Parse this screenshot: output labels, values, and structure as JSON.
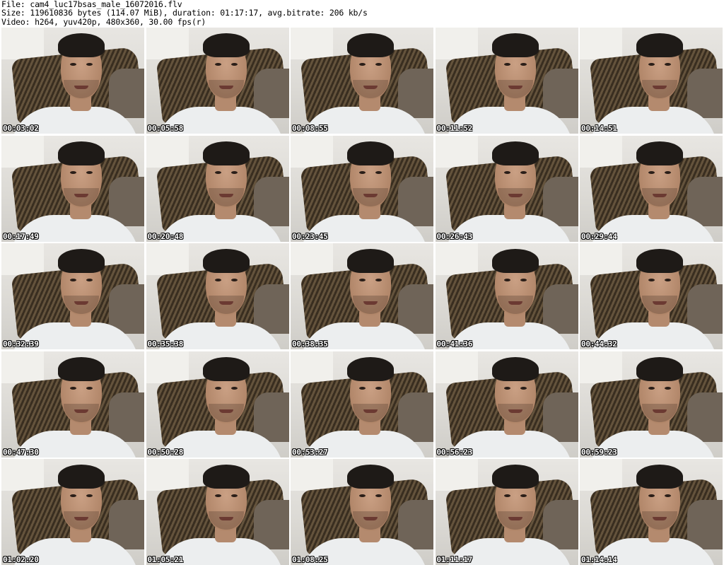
{
  "header": {
    "file_line": "File: cam4_luc17bsas_male_16072016.flv",
    "size_line": "Size: 119610836 bytes (114.07 MiB), duration: 01:17:17, avg.bitrate: 206 kb/s",
    "video_line": "Video: h264, yuv420p, 480x360, 30.00 fps(r)"
  },
  "thumbnails": [
    {
      "timestamp": "00:03:02"
    },
    {
      "timestamp": "00:05:58"
    },
    {
      "timestamp": "00:08:55"
    },
    {
      "timestamp": "00:11:52"
    },
    {
      "timestamp": "00:14:51"
    },
    {
      "timestamp": "00:17:49"
    },
    {
      "timestamp": "00:20:48"
    },
    {
      "timestamp": "00:23:45"
    },
    {
      "timestamp": "00:26:43"
    },
    {
      "timestamp": "00:29:44"
    },
    {
      "timestamp": "00:32:39"
    },
    {
      "timestamp": "00:35:38"
    },
    {
      "timestamp": "00:38:35"
    },
    {
      "timestamp": "00:41:36"
    },
    {
      "timestamp": "00:44:32"
    },
    {
      "timestamp": "00:47:30"
    },
    {
      "timestamp": "00:50:28"
    },
    {
      "timestamp": "00:53:27"
    },
    {
      "timestamp": "00:56:23"
    },
    {
      "timestamp": "00:59:23"
    },
    {
      "timestamp": "01:02:20"
    },
    {
      "timestamp": "01:05:21"
    },
    {
      "timestamp": "01:08:25"
    },
    {
      "timestamp": "01:11:17"
    },
    {
      "timestamp": "01:14:14"
    }
  ]
}
